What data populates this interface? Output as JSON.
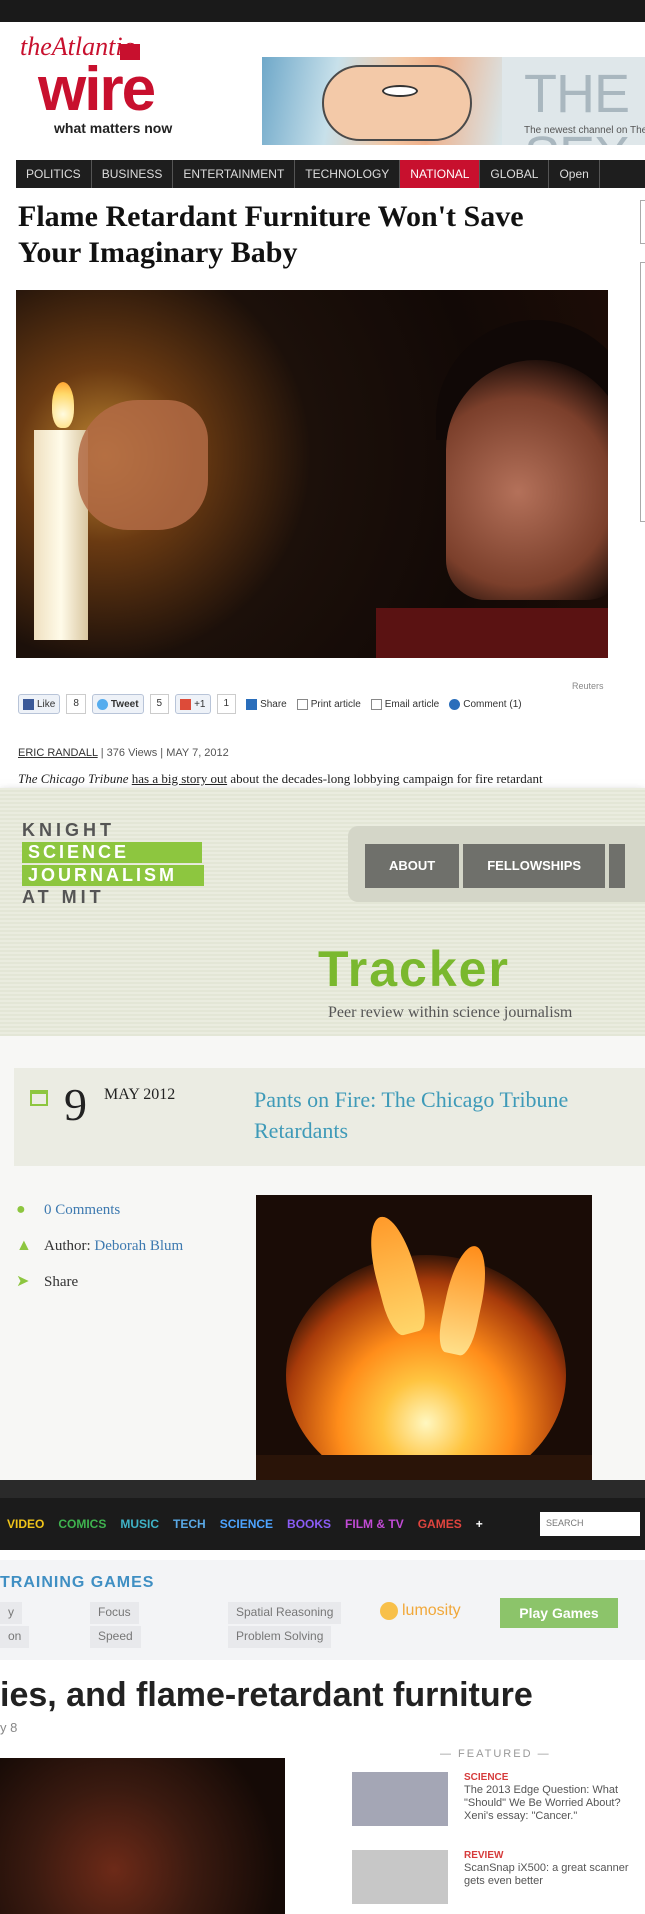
{
  "panel1": {
    "logo": {
      "the": "the",
      "atlantic": "Atlantic",
      "wire": "wire",
      "tagline": "what matters now"
    },
    "banner": {
      "big": "THE SEX",
      "small": "The newest channel on TheA"
    },
    "nav": [
      "POLITICS",
      "BUSINESS",
      "ENTERTAINMENT",
      "TECHNOLOGY",
      "NATIONAL",
      "GLOBAL",
      "Open"
    ],
    "headline": "Flame Retardant Furniture Won't Save Your Imaginary Baby",
    "photo_credit": "Reuters",
    "social": {
      "like_label": "Like",
      "like_count": "8",
      "tweet_label": "Tweet",
      "tweet_count": "5",
      "gplus_label": "+1",
      "gplus_count": "1",
      "share_label": "Share",
      "print_label": "Print article",
      "email_label": "Email article",
      "comment_label": "Comment (1)"
    },
    "byline": {
      "author": "ERIC RANDALL",
      "views": "376 Views",
      "date": "MAY 7, 2012"
    },
    "intro": {
      "pub": "The Chicago Tribune",
      "link": "has a big story out",
      "rest": "about the decades-long lobbying campaign for fire retardant products that has ignored their health hazards while pushing products that don't actually..."
    }
  },
  "panel2": {
    "logo": [
      "KNIGHT",
      "SCIENCE",
      "JOURNALISM",
      "AT MIT"
    ],
    "nav": [
      "ABOUT",
      "FELLOWSHIPS"
    ],
    "tracker": "Tracker",
    "tracker_sub": "Peer review within science journalism",
    "post": {
      "day": "9",
      "month": "MAY 2012",
      "title": "Pants on Fire: The Chicago Tribune Retardants"
    },
    "meta": {
      "comments": "0 Comments",
      "author_label": "Author:",
      "author": "Deborah Blum",
      "share": "Share"
    }
  },
  "panel3": {
    "nav": [
      {
        "label": "VIDEO",
        "color": "#f0c419"
      },
      {
        "label": "COMICS",
        "color": "#3fb34f"
      },
      {
        "label": "MUSIC",
        "color": "#3fb3c7"
      },
      {
        "label": "TECH",
        "color": "#5aa9e6"
      },
      {
        "label": "SCIENCE",
        "color": "#4da3ff"
      },
      {
        "label": "BOOKS",
        "color": "#8b5cf6"
      },
      {
        "label": "FILM & TV",
        "color": "#c24bd6"
      },
      {
        "label": "GAMES",
        "color": "#e0443e"
      },
      {
        "label": "+",
        "color": "#ffffff"
      }
    ],
    "search_placeholder": "SEARCH",
    "training_title": "TRAINING GAMES",
    "chips": [
      "y",
      "Focus",
      "Spatial Reasoning",
      "on",
      "Speed",
      "Problem Solving"
    ],
    "lumosity": "lumosity",
    "play": "Play Games",
    "headline": "ies, and flame-retardant furniture",
    "subline": "y 8",
    "featured": "— FEATURED —",
    "features": [
      {
        "cat": "SCIENCE",
        "text": "The 2013 Edge Question: What \"Should\" We Be Worried About? Xeni's essay: \"Cancer.\""
      },
      {
        "cat": "REVIEW",
        "text": "ScanSnap iX500: a great scanner gets even better"
      }
    ]
  }
}
